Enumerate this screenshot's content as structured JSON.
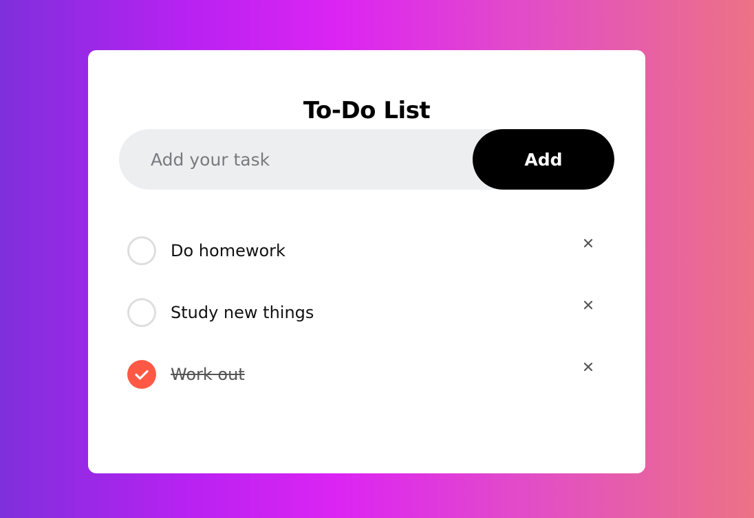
{
  "app": {
    "title": "To-Do List"
  },
  "input": {
    "placeholder": "Add your task",
    "value": ""
  },
  "add_button": {
    "label": "Add"
  },
  "tasks": [
    {
      "text": "Do homework",
      "checked": false
    },
    {
      "text": "Study new things",
      "checked": false
    },
    {
      "text": "Work out",
      "checked": true
    }
  ],
  "icons": {
    "checkbox_checked": "check-icon",
    "remove": "close-icon"
  },
  "colors": {
    "accent": "#ff5945",
    "button": "#000000",
    "input_background": "#edeef0",
    "gradient_start": "#7f2fdc",
    "gradient_end": "#ec7285"
  }
}
